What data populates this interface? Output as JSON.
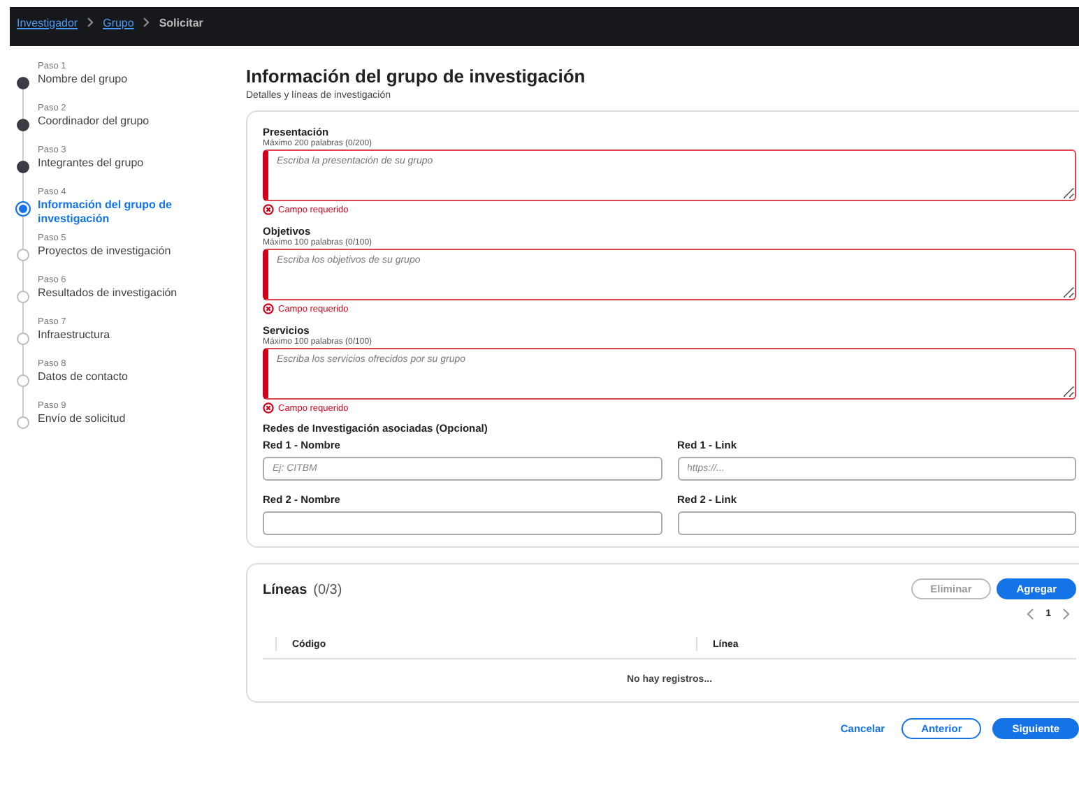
{
  "breadcrumb": [
    {
      "label": "Investigador",
      "link": true
    },
    {
      "label": "Grupo",
      "link": true
    },
    {
      "label": "Solicitar",
      "link": false
    }
  ],
  "steps": [
    {
      "step": "Paso 1",
      "label": "Nombre del grupo",
      "completed": true,
      "selected": false
    },
    {
      "step": "Paso 2",
      "label": "Coordinador del grupo",
      "completed": true,
      "selected": false
    },
    {
      "step": "Paso 3",
      "label": "Integrantes del grupo",
      "completed": true,
      "selected": false
    },
    {
      "step": "Paso 4",
      "label": "Información del grupo de investigación",
      "completed": false,
      "selected": true
    },
    {
      "step": "Paso 5",
      "label": "Proyectos de investigación",
      "completed": false,
      "selected": false
    },
    {
      "step": "Paso 6",
      "label": "Resultados de investigación",
      "completed": false,
      "selected": false
    },
    {
      "step": "Paso 7",
      "label": "Infraestructura",
      "completed": false,
      "selected": false
    },
    {
      "step": "Paso 8",
      "label": "Datos de contacto",
      "completed": false,
      "selected": false
    },
    {
      "step": "Paso 9",
      "label": "Envío de solicitud",
      "completed": false,
      "selected": false
    }
  ],
  "title": "Información del grupo de investigación",
  "subtitle": "Detalles y líneas de investigación",
  "textareas": [
    {
      "label": "Presentación",
      "hint": "Máximo 200 palabras (0/200)",
      "placeholder": "Escriba la presentación de su grupo",
      "invalid": true,
      "error": "Campo requerido"
    },
    {
      "label": "Objetivos",
      "hint": "Máximo 100 palabras (0/100)",
      "placeholder": "Escriba los objetivos de su grupo",
      "invalid": true,
      "error": "Campo requerido"
    },
    {
      "label": "Servicios",
      "hint": "Máximo 100 palabras (0/100)",
      "placeholder": "Escriba los servicios ofrecidos por su grupo",
      "invalid": true,
      "error": "Campo requerido"
    }
  ],
  "networks": {
    "title": "Redes de Investigación asociadas (Opcional)",
    "fields": [
      {
        "label": "Red 1 - Nombre",
        "placeholder": "Ej: CITBM"
      },
      {
        "label": "Red 1 - Link",
        "placeholder": "https://..."
      },
      {
        "label": "Red 2 - Nombre"
      },
      {
        "label": "Red 2 - Link"
      }
    ]
  },
  "lines": {
    "title": "Líneas",
    "count": "(0/3)",
    "delete_button": {
      "label": "Eliminar",
      "disabled": true
    },
    "add_button": "Agregar",
    "page": "1",
    "columns": [
      "Código",
      "Línea"
    ],
    "empty": "No hay registros..."
  },
  "footer": {
    "cancel": "Cancelar",
    "back": "Anterior",
    "next": "Siguiente"
  }
}
